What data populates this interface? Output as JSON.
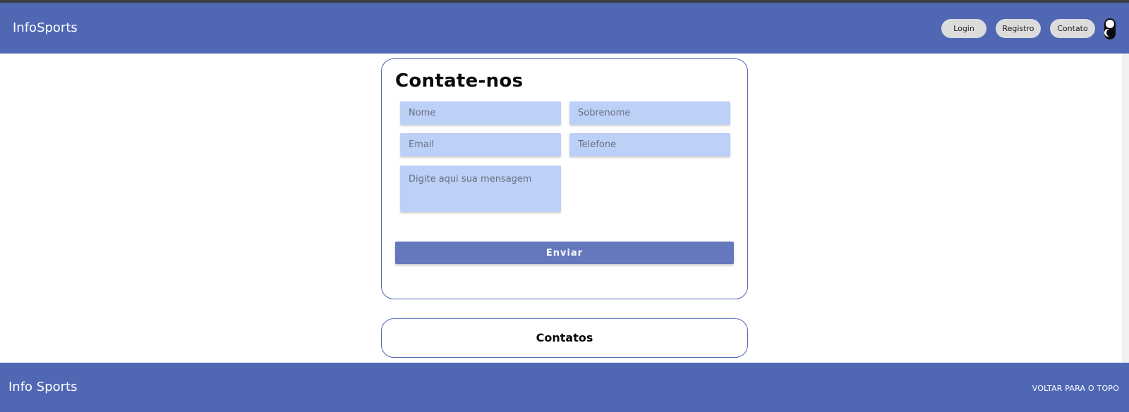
{
  "header": {
    "brand": "InfoSports",
    "nav": {
      "login": "Login",
      "registro": "Registro",
      "contato": "Contato"
    }
  },
  "contact_form": {
    "title": "Contate-nos",
    "fields": {
      "nome_placeholder": "Nome",
      "sobrenome_placeholder": "Sobrenome",
      "email_placeholder": "Email",
      "telefone_placeholder": "Telefone",
      "mensagem_placeholder": "Digite aqui sua mensagem"
    },
    "submit_label": "Enviar"
  },
  "contacts_section": {
    "title": "Contatos"
  },
  "footer": {
    "brand": "Info Sports",
    "back_to_top": "VOLTAR PARA O TOPO"
  },
  "colors": {
    "primary": "#5067b4",
    "input_bg": "#bcd0f8",
    "button_bg": "#6678bd",
    "nav_button_bg": "#dcdcdc"
  }
}
